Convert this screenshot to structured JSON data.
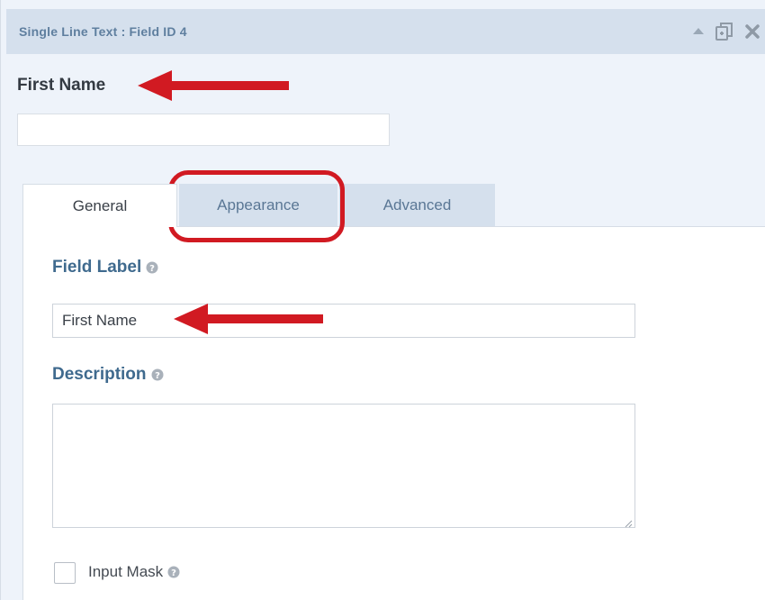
{
  "header": {
    "title": "Single Line Text : Field ID 4",
    "icons": [
      "collapse-up-icon",
      "duplicate-icon",
      "close-icon"
    ]
  },
  "preview": {
    "label": "First Name",
    "input_value": ""
  },
  "tabs": [
    {
      "label": "General",
      "active": true
    },
    {
      "label": "Appearance",
      "active": false
    },
    {
      "label": "Advanced",
      "active": false
    }
  ],
  "general": {
    "field_label_heading": "Field Label",
    "field_label_value": "First Name",
    "description_heading": "Description",
    "description_value": "",
    "input_mask_label": "Input Mask",
    "input_mask_checked": false
  },
  "colors": {
    "header_bg": "#d5e0ed",
    "panel_bg": "#eef3fa",
    "label_blue": "#3f6a8e",
    "annotation_red": "#d11a22"
  }
}
